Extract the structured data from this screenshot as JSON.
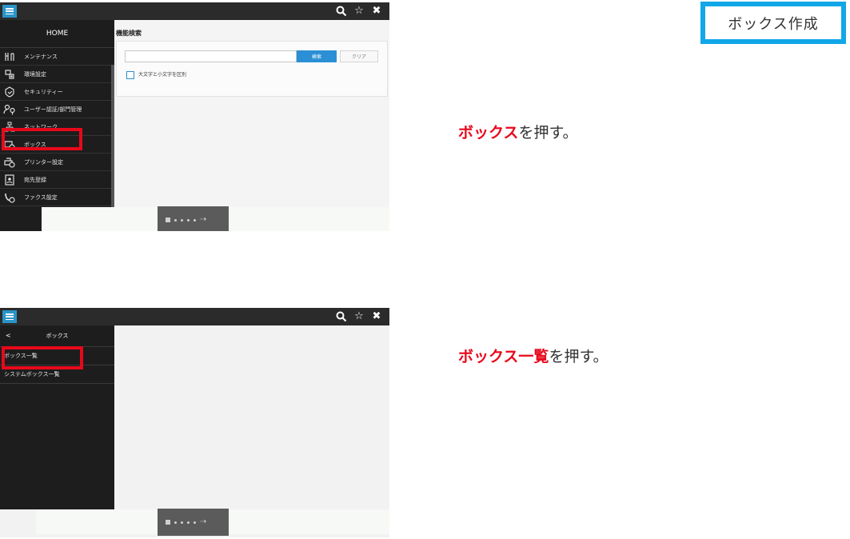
{
  "screen1": {
    "sidebar": {
      "home_label": "HOME",
      "items": [
        {
          "label": "メンテナンス",
          "icon": "maintenance-icon"
        },
        {
          "label": "環境設定",
          "icon": "environment-settings-icon"
        },
        {
          "label": "セキュリティー",
          "icon": "security-shield-icon"
        },
        {
          "label": "ユーザー認証/部門管理",
          "icon": "user-auth-icon"
        },
        {
          "label": "ネットワーク",
          "icon": "network-icon"
        },
        {
          "label": "ボックス",
          "icon": "box-icon"
        },
        {
          "label": "プリンター設定",
          "icon": "printer-settings-icon"
        },
        {
          "label": "宛先登録",
          "icon": "address-register-icon"
        },
        {
          "label": "ファクス設定",
          "icon": "fax-settings-icon"
        }
      ]
    },
    "function_search": {
      "title": "機能検索",
      "input_value": "",
      "search_label": "検索",
      "clear_label": "クリア",
      "checkbox_label": "大文字と小文字を区別"
    }
  },
  "screen2": {
    "sidebar": {
      "back_label": "<",
      "title": "ボックス",
      "items": [
        {
          "label": "ボックス一覧"
        },
        {
          "label": "システムボックス一覧"
        }
      ]
    }
  },
  "topbar": {
    "icons": [
      "menu-icon",
      "search-icon",
      "favorite-star-icon",
      "close-icon"
    ]
  },
  "right": {
    "create_button_label": "ボックス作成",
    "instruction1": {
      "highlight": "ボックス",
      "rest": "を押す。"
    },
    "instruction2": {
      "highlight": "ボックス一覧",
      "rest": "を押す。"
    }
  },
  "colors": {
    "accent_blue": "#2a8fd4",
    "highlight_red": "#e8081b",
    "frame_cyan": "#11a7e8",
    "sidebar_dark": "#1d1d1d"
  }
}
